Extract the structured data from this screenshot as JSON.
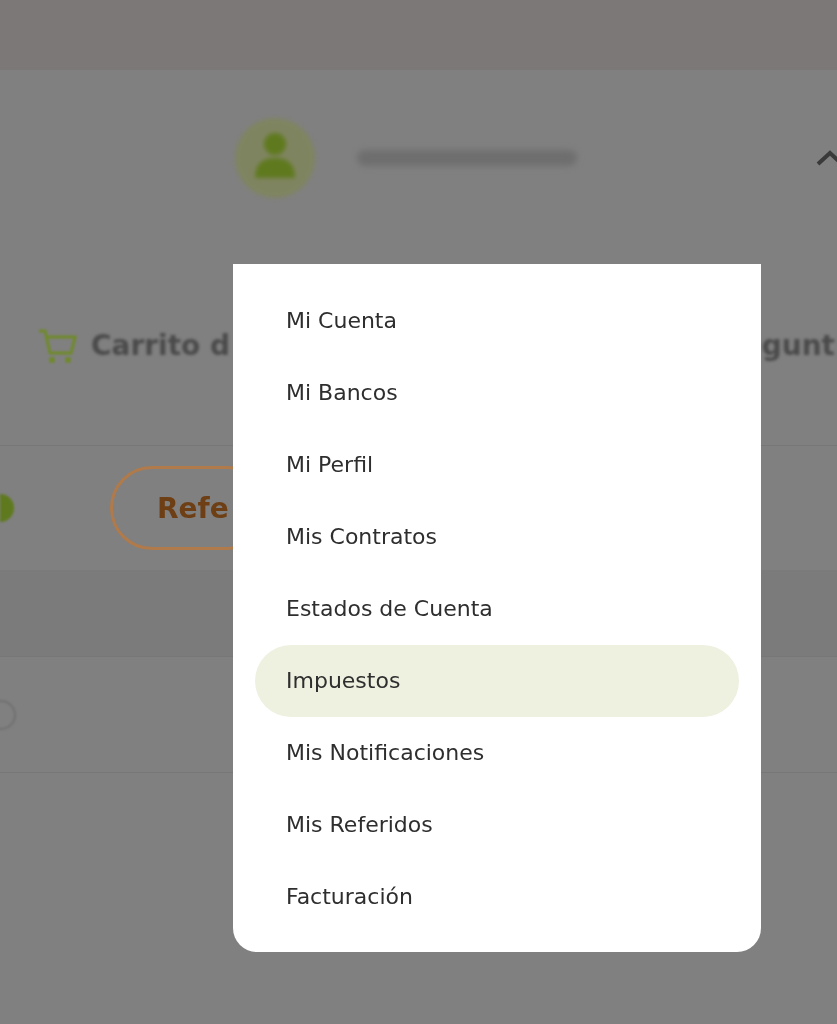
{
  "background": {
    "nav_label": "Carrito d",
    "button_label": "Refe",
    "right_label": "gunt"
  },
  "menu": {
    "items": [
      {
        "label": "Mi Cuenta",
        "selected": false
      },
      {
        "label": "Mi Bancos",
        "selected": false
      },
      {
        "label": "Mi Perfil",
        "selected": false
      },
      {
        "label": "Mis Contratos",
        "selected": false
      },
      {
        "label": "Estados de Cuenta",
        "selected": false
      },
      {
        "label": "Impuestos",
        "selected": true
      },
      {
        "label": "Mis Notificaciones",
        "selected": false
      },
      {
        "label": "Mis Referidos",
        "selected": false
      },
      {
        "label": "Facturación",
        "selected": false
      }
    ]
  }
}
